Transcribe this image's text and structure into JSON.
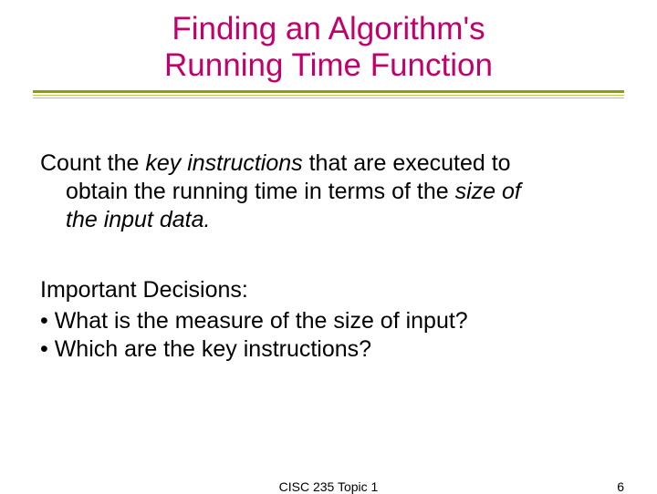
{
  "title_line1": "Finding an Algorithm's",
  "title_line2": "Running Time Function",
  "para1": {
    "lead": "Count the ",
    "key_instr": "key instructions",
    "mid": " that are executed to",
    "line2a": "obtain the running time in terms of the ",
    "size_of": "size of",
    "line3": "the input data."
  },
  "decisions_label": "Important Decisions:",
  "bullet1": "•  What is the measure of the size of input?",
  "bullet2": "•  Which are the key instructions?",
  "footer_center": "CISC 235 Topic 1",
  "footer_right": "6"
}
